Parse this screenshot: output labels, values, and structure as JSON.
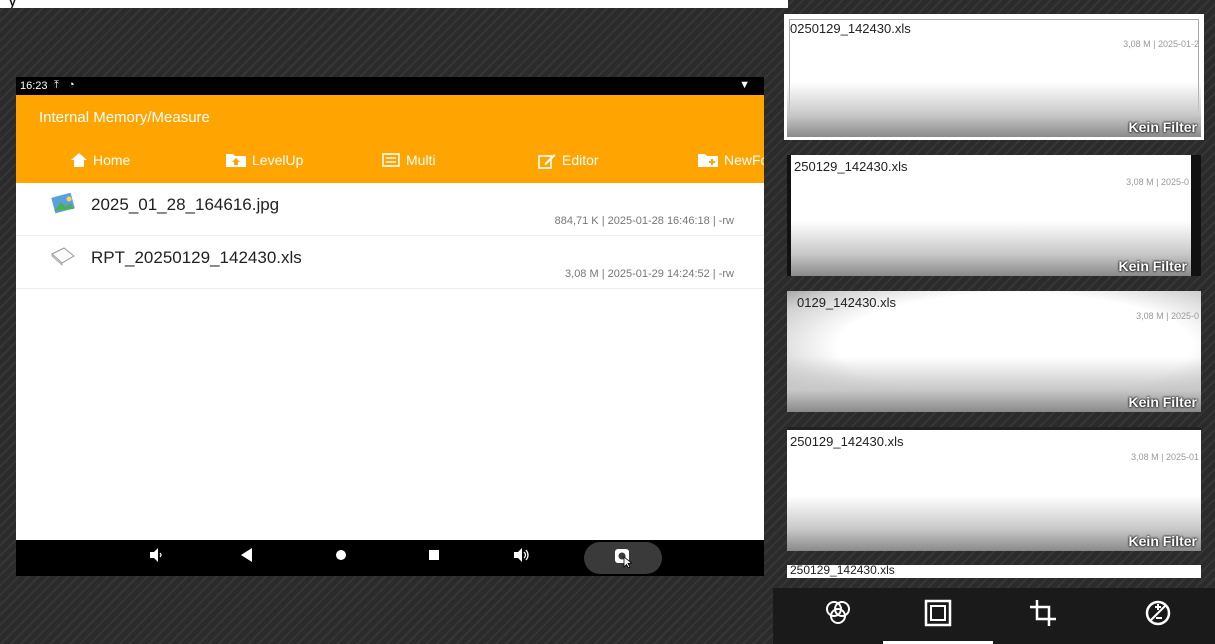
{
  "top_caption": "y",
  "status_bar": {
    "time": "16:23"
  },
  "app": {
    "path": "Internal Memory/Measure",
    "toolbar": [
      {
        "label": "Home",
        "icon": "home-icon"
      },
      {
        "label": "LevelUp",
        "icon": "folder-up-icon"
      },
      {
        "label": "Multi",
        "icon": "multi-select-icon"
      },
      {
        "label": "Editor",
        "icon": "edit-icon"
      },
      {
        "label": "NewFc",
        "icon": "new-folder-icon"
      }
    ],
    "files": [
      {
        "name": "2025_01_28_164616.jpg",
        "meta": "884,71 K | 2025-01-28 16:46:18 | -rw",
        "icon": "image-file-icon"
      },
      {
        "name": "RPT_20250129_142430.xls",
        "meta": "3,08 M | 2025-01-29 14:24:52 | -rw",
        "icon": "document-file-icon"
      }
    ]
  },
  "nav_bar": [
    "volume-down-icon",
    "back-icon",
    "home-circle-icon",
    "recents-icon",
    "volume-up-icon",
    "screenshot-icon"
  ],
  "thumbnails": [
    {
      "name": "0250129_142430.xls",
      "meta": "3,08 M | 2025-01-2",
      "filter": "Kein Filter"
    },
    {
      "name": "250129_142430.xls",
      "meta": "3,08 M | 2025-0",
      "filter": "Kein Filter"
    },
    {
      "name": "0129_142430.xls",
      "meta": "3,08 M | 2025-0",
      "filter": "Kein Filter"
    },
    {
      "name": "250129_142430.xls",
      "meta": "3,08 M | 2025-01",
      "filter": "Kein Filter"
    },
    {
      "name": "250129_142430.xls",
      "meta": "",
      "filter": ""
    }
  ],
  "bottom_tools": [
    "filters-icon",
    "frame-icon",
    "crop-icon",
    "adjust-icon"
  ]
}
